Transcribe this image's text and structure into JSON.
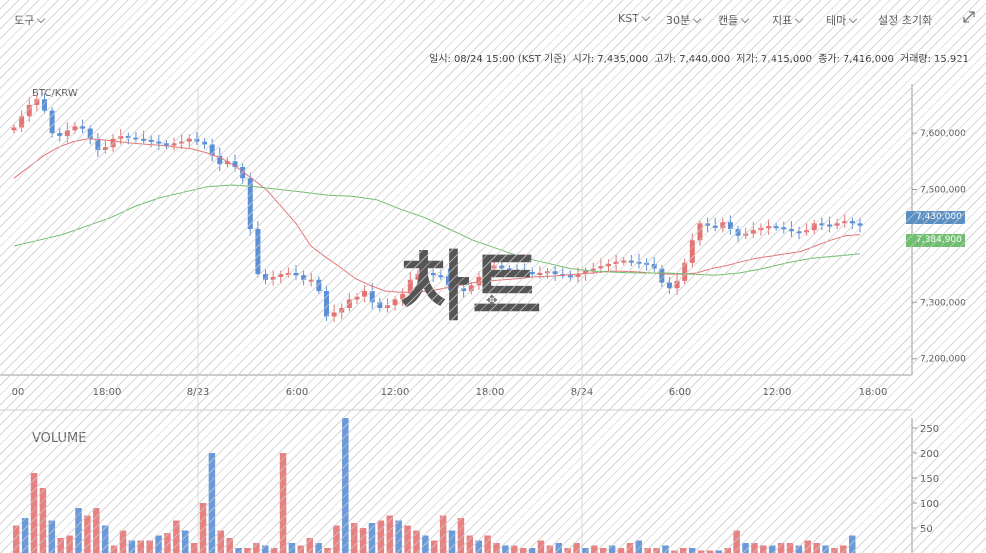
{
  "toolbar": {
    "tools_label": "도구",
    "timezone": "KST",
    "interval": "30분",
    "chart_type": "캔들",
    "indicators": "지표",
    "theme": "테마",
    "reset_label": "설정 초기화"
  },
  "info_bar": {
    "datetime_label": "일시:",
    "datetime": "08/24 15:00 (KST 기준)",
    "open_label": "시가:",
    "open": "7,435,000",
    "high_label": "고가:",
    "high": "7,440,000",
    "low_label": "저가:",
    "low": "7,415,000",
    "close_label": "종가:",
    "close": "7,416,000",
    "volume_label": "거래량:",
    "volume": "15.921"
  },
  "overlay_text": "차트",
  "colors": {
    "up": "#e57373",
    "down": "#5b8fd6",
    "ma_short": "#e57373",
    "ma_long": "#6cbf6c"
  },
  "chart_data": [
    {
      "type": "candlestick",
      "title": "BTC/KRW",
      "x_ticks": [
        "00",
        "18:00",
        "8/23",
        "6:00",
        "12:00",
        "18:00",
        "8/24",
        "6:00",
        "12:00",
        "18:00"
      ],
      "y_ticks": [
        "7,600,000",
        "7,500,000",
        "7,300,000",
        "7,200,000"
      ],
      "ylim": [
        7180000,
        7680000
      ],
      "current_price_tag": "7,430,000",
      "ma_tag": "7,384,900",
      "series": [
        {
          "name": "price",
          "values": [
            7610000,
            7630000,
            7650000,
            7660000,
            7640000,
            7600000,
            7595000,
            7605000,
            7612000,
            7608000,
            7590000,
            7570000,
            7575000,
            7590000,
            7595000,
            7592000,
            7590000,
            7588000,
            7585000,
            7582000,
            7578000,
            7582000,
            7585000,
            7590000,
            7585000,
            7580000,
            7560000,
            7545000,
            7550000,
            7540000,
            7520000,
            7430000,
            7350000,
            7340000,
            7345000,
            7350000,
            7352000,
            7348000,
            7340000,
            7340000,
            7320000,
            7275000,
            7282000,
            7290000,
            7305000,
            7310000,
            7320000,
            7300000,
            7290000,
            7295000,
            7305000,
            7315000,
            7340000,
            7350000,
            7352000,
            7348000,
            7346000,
            7330000,
            7325000,
            7320000,
            7330000,
            7345000,
            7360000,
            7365000,
            7360000,
            7358000,
            7355000,
            7354000,
            7350000,
            7352000,
            7355000,
            7350000,
            7348000,
            7345000,
            7350000,
            7356000,
            7360000,
            7364000,
            7368000,
            7372000,
            7374000,
            7372000,
            7370000,
            7368000,
            7360000,
            7335000,
            7325000,
            7338000,
            7370000,
            7410000,
            7440000,
            7436000,
            7432000,
            7442000,
            7430000,
            7418000,
            7422000,
            7428000,
            7432000,
            7435000,
            7433000,
            7430000,
            7426000,
            7424000,
            7428000,
            7440000,
            7438000,
            7436000,
            7440000,
            7444000,
            7440000,
            7436000
          ]
        },
        {
          "name": "MA short",
          "values": [
            7520000,
            7540000,
            7560000,
            7575000,
            7585000,
            7590000,
            7588000,
            7585000,
            7582000,
            7580000,
            7578000,
            7575000,
            7572000,
            7565000,
            7555000,
            7540000,
            7520000,
            7500000,
            7470000,
            7440000,
            7400000,
            7380000,
            7362000,
            7342000,
            7330000,
            7320000,
            7318000,
            7318000,
            7320000,
            7325000,
            7330000,
            7335000,
            7338000,
            7340000,
            7342000,
            7345000,
            7346000,
            7348000,
            7350000,
            7352000,
            7355000,
            7355000,
            7354000,
            7352000,
            7350000,
            7350000,
            7352000,
            7360000,
            7365000,
            7372000,
            7378000,
            7382000,
            7386000,
            7390000,
            7400000,
            7410000,
            7418000,
            7420000
          ]
        },
        {
          "name": "MA long",
          "values": [
            7400000,
            7410000,
            7420000,
            7435000,
            7450000,
            7470000,
            7485000,
            7495000,
            7505000,
            7508000,
            7505000,
            7500000,
            7495000,
            7490000,
            7488000,
            7482000,
            7465000,
            7450000,
            7430000,
            7410000,
            7395000,
            7380000,
            7370000,
            7360000,
            7355000,
            7353000,
            7352000,
            7352000,
            7350000,
            7348000,
            7352000,
            7360000,
            7370000,
            7378000,
            7382000,
            7386000
          ]
        }
      ]
    },
    {
      "type": "bar",
      "title": "VOLUME",
      "y_ticks": [
        "250",
        "200",
        "150",
        "100",
        "50"
      ],
      "ylim": [
        0,
        270
      ],
      "values": [
        55,
        70,
        160,
        130,
        65,
        30,
        35,
        90,
        75,
        90,
        55,
        15,
        45,
        25,
        25,
        25,
        35,
        40,
        65,
        45,
        20,
        100,
        200,
        45,
        30,
        10,
        10,
        20,
        15,
        10,
        200,
        20,
        15,
        30,
        20,
        10,
        55,
        270,
        60,
        50,
        60,
        65,
        75,
        65,
        55,
        45,
        35,
        25,
        75,
        45,
        70,
        35,
        25,
        35,
        20,
        15,
        15,
        10,
        10,
        25,
        15,
        20,
        10,
        20,
        10,
        15,
        10,
        15,
        10,
        20,
        25,
        10,
        10,
        15,
        5,
        10,
        10,
        5,
        5,
        5,
        10,
        45,
        20,
        20,
        15,
        15,
        20,
        20,
        15,
        25,
        20,
        15,
        10,
        15,
        35
      ]
    }
  ]
}
